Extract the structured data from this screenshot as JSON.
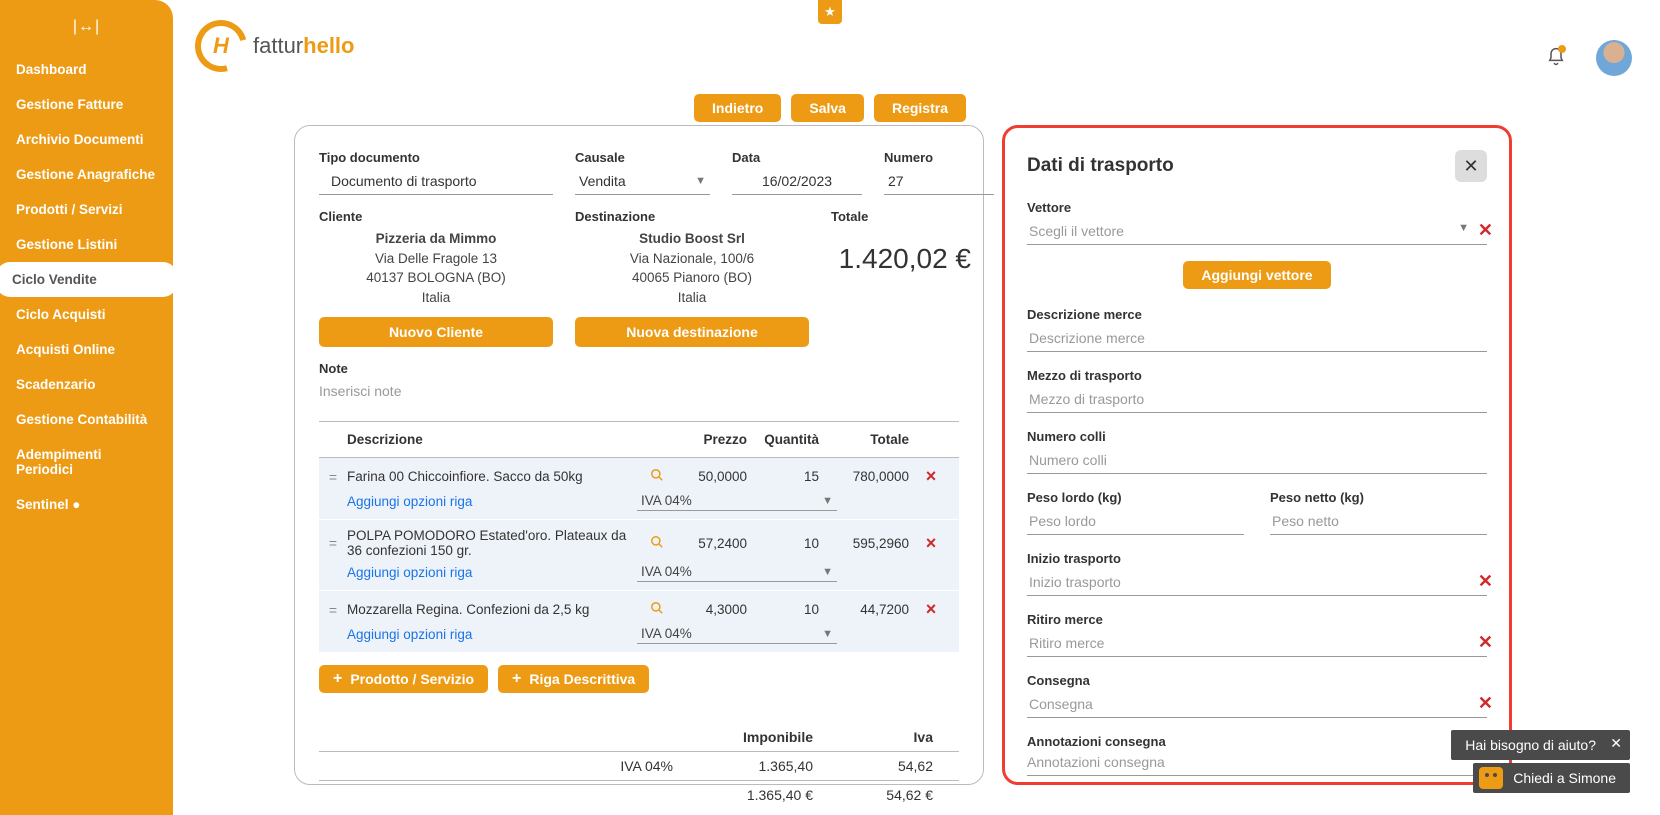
{
  "brand": {
    "first": "fattur",
    "second": "hello"
  },
  "sidebar": {
    "collapse_icon": "|↔|",
    "items": [
      {
        "label": "Dashboard"
      },
      {
        "label": "Gestione Fatture"
      },
      {
        "label": "Archivio Documenti"
      },
      {
        "label": "Gestione Anagrafiche"
      },
      {
        "label": "Prodotti / Servizi"
      },
      {
        "label": "Gestione Listini"
      },
      {
        "label": "Ciclo Vendite",
        "active": true
      },
      {
        "label": "Ciclo Acquisti"
      },
      {
        "label": "Acquisti Online"
      },
      {
        "label": "Scadenzario"
      },
      {
        "label": "Gestione Contabilità"
      },
      {
        "label": "Adempimenti Periodici"
      },
      {
        "label": "Sentinel ●"
      }
    ]
  },
  "actions": {
    "back": "Indietro",
    "save": "Salva",
    "register": "Registra"
  },
  "doc": {
    "tipo_label": "Tipo documento",
    "tipo_value": "Documento di trasporto",
    "causale_label": "Causale",
    "causale_value": "Vendita",
    "data_label": "Data",
    "data_value": "16/02/2023",
    "numero_label": "Numero",
    "numero_value": "27",
    "cliente_label": "Cliente",
    "cliente": {
      "name": "Pizzeria da Mimmo",
      "addr1": "Via Delle Fragole 13",
      "addr2": "40137 BOLOGNA (BO)",
      "country": "Italia"
    },
    "new_client": "Nuovo Cliente",
    "dest_label": "Destinazione",
    "dest": {
      "name": "Studio Boost Srl",
      "addr1": "Via Nazionale, 100/6",
      "addr2": "40065 Pianoro (BO)",
      "country": "Italia"
    },
    "new_dest": "Nuova destinazione",
    "totale_label": "Totale",
    "totale_value": "1.420,02 €",
    "note_label": "Note",
    "note_placeholder": "Inserisci note"
  },
  "table": {
    "h_desc": "Descrizione",
    "h_price": "Prezzo",
    "h_qty": "Quantità",
    "h_total": "Totale",
    "opt_link": "Aggiungi opzioni riga",
    "iva_label": "IVA 04%",
    "rows": [
      {
        "desc": "Farina 00  Chiccoinfiore. Sacco da 50kg",
        "price": "50,0000",
        "qty": "15",
        "total": "780,0000"
      },
      {
        "desc": "POLPA POMODORO Estated'oro. Plateaux  da 36 confezioni 150 gr.",
        "price": "57,2400",
        "qty": "10",
        "total": "595,2960"
      },
      {
        "desc": "Mozzarella Regina. Confezioni da 2,5 kg",
        "price": "4,3000",
        "qty": "10",
        "total": "44,7200"
      }
    ],
    "add_product": "Prodotto / Servizio",
    "add_descrow": "Riga Descrittiva"
  },
  "totals": {
    "imponibile_h": "Imponibile",
    "iva_h": "Iva",
    "iva_label": "IVA 04%",
    "imponibile": "1.365,40",
    "iva": "54,62",
    "imp_final": "1.365,40 €",
    "iva_final": "54,62 €"
  },
  "transport": {
    "title": "Dati di trasporto",
    "vettore_label": "Vettore",
    "vettore_placeholder": "Scegli il vettore",
    "add_vettore": "Aggiungi vettore",
    "desc_label": "Descrizione merce",
    "desc_placeholder": "Descrizione merce",
    "mezzo_label": "Mezzo di trasporto",
    "mezzo_placeholder": "Mezzo di trasporto",
    "colli_label": "Numero colli",
    "colli_placeholder": "Numero colli",
    "pl_label": "Peso lordo (kg)",
    "pl_placeholder": "Peso lordo",
    "pn_label": "Peso netto (kg)",
    "pn_placeholder": "Peso netto",
    "inizio_label": "Inizio trasporto",
    "inizio_placeholder": "Inizio trasporto",
    "ritiro_label": "Ritiro merce",
    "ritiro_placeholder": "Ritiro merce",
    "consegna_label": "Consegna",
    "consegna_placeholder": "Consegna",
    "annot_label": "Annotazioni consegna",
    "annot_placeholder": "Annotazioni consegna"
  },
  "help": {
    "text": "Hai bisogno di aiuto?",
    "chat": "Chiedi a Simone"
  }
}
